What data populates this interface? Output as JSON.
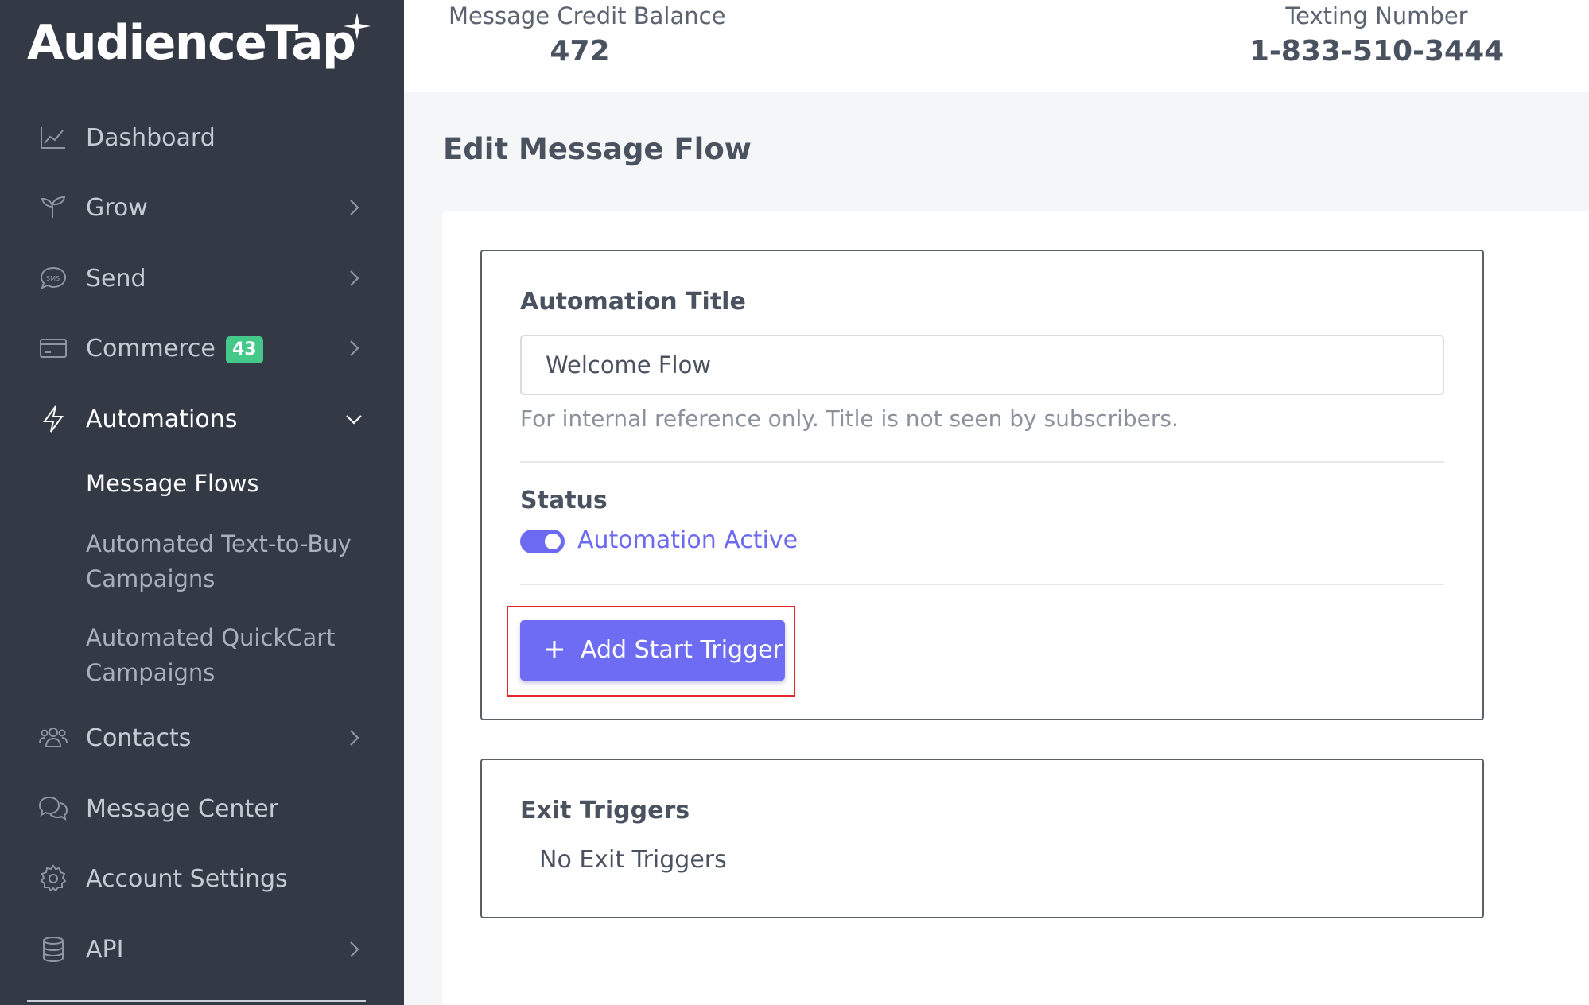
{
  "brand": {
    "name": "AudienceTap"
  },
  "header": {
    "credit_label": "Message Credit Balance",
    "credit_value": "472",
    "number_label": "Texting Number",
    "number_value": "1-833-510-3444"
  },
  "sidebar": {
    "items": [
      {
        "label": "Dashboard",
        "icon": "chart-line-icon"
      },
      {
        "label": "Grow",
        "icon": "sprout-icon"
      },
      {
        "label": "Send",
        "icon": "sms-bubble-icon"
      },
      {
        "label": "Commerce",
        "icon": "credit-card-icon",
        "badge": "43"
      },
      {
        "label": "Automations",
        "icon": "lightning-icon"
      },
      {
        "label": "Contacts",
        "icon": "users-icon"
      },
      {
        "label": "Message Center",
        "icon": "chat-bubbles-icon"
      },
      {
        "label": "Account Settings",
        "icon": "gear-icon"
      },
      {
        "label": "API",
        "icon": "database-icon"
      }
    ],
    "automations_sub": [
      {
        "label": "Message Flows"
      },
      {
        "label": "Automated Text-to-Buy Campaigns"
      },
      {
        "label": "Automated QuickCart Campaigns"
      }
    ]
  },
  "page": {
    "title": "Edit Message Flow"
  },
  "form": {
    "title_label": "Automation Title",
    "title_value": "Welcome Flow",
    "title_help": "For internal reference only. Title is not seen by subscribers.",
    "status_label": "Status",
    "status_text": "Automation Active",
    "status_active": true,
    "add_trigger_label": "Add Start Trigger"
  },
  "exit": {
    "label": "Exit Triggers",
    "empty_text": "No Exit Triggers"
  },
  "colors": {
    "sidebar_bg": "#333945",
    "accent": "#6e6cf2",
    "badge_green": "#45c98b",
    "highlight_red": "#e4262f"
  }
}
